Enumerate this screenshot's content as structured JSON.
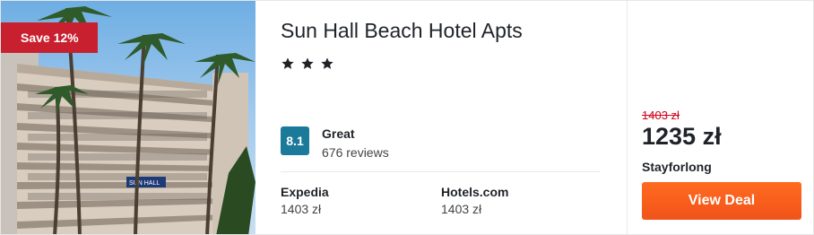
{
  "badge": {
    "label": "Save 12%"
  },
  "hotel": {
    "name": "Sun Hall Beach Hotel Apts",
    "star_count": 3
  },
  "rating": {
    "score": "8.1",
    "word": "Great",
    "reviews": "676 reviews"
  },
  "providers": [
    {
      "name": "Expedia",
      "price": "1403 zł"
    },
    {
      "name": "Hotels.com",
      "price": "1403 zł"
    }
  ],
  "deal": {
    "old_price": "1403 zł",
    "price": "1235 zł",
    "source": "Stayforlong",
    "button_label": "View Deal"
  },
  "photo": {
    "sign_text": "SUN HALL"
  },
  "colors": {
    "badge": "#c8202f",
    "score": "#1b7a9a",
    "button": "#f1531a",
    "old_price": "#d0021b"
  }
}
